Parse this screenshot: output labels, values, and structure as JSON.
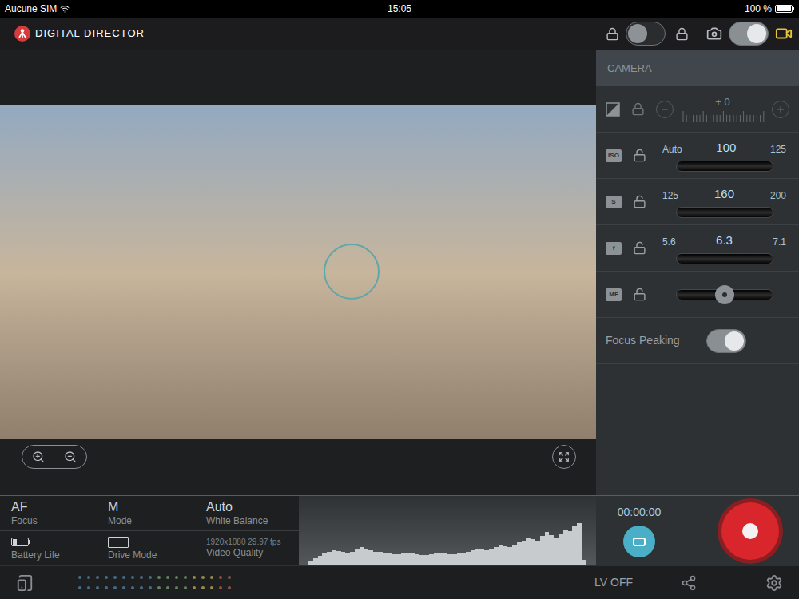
{
  "status_bar": {
    "carrier": "Aucune SIM",
    "time": "15:05",
    "battery": "100 %"
  },
  "app": {
    "title": "DIGITAL DIRECTOR"
  },
  "header": {
    "lock_switch": {
      "on": false
    },
    "mode_switch": {
      "video_selected": true
    }
  },
  "camera_panel": {
    "title": "CAMERA",
    "rows": [
      {
        "kind": "exposure",
        "value": "+ 0",
        "locked": true,
        "disabled": true
      },
      {
        "kind": "dial",
        "badge": "ISO",
        "locked": false,
        "left": "Auto",
        "value": "100",
        "right": "125"
      },
      {
        "kind": "dial",
        "badge": "S",
        "locked": false,
        "left": "125",
        "value": "160",
        "right": "200"
      },
      {
        "kind": "dial",
        "badge": "f",
        "locked": false,
        "left": "5.6",
        "value": "6.3",
        "right": "7.1"
      },
      {
        "kind": "focus",
        "badge": "MF",
        "locked": false,
        "level": 0.5
      },
      {
        "kind": "toggle",
        "label": "Focus Peaking",
        "on": true
      }
    ]
  },
  "info": [
    {
      "kind": "text",
      "value": "AF",
      "label": "Focus"
    },
    {
      "kind": "text",
      "value": "M",
      "label": "Mode"
    },
    {
      "kind": "text",
      "value": "Auto",
      "label": "White Balance"
    },
    {
      "kind": "battery",
      "level": 0.3,
      "label": "Battery Life"
    },
    {
      "kind": "drive",
      "label": "Drive Mode"
    },
    {
      "kind": "small",
      "value": "1920x1080 29.97 fps",
      "label": "Video Quality"
    }
  ],
  "histogram": {
    "values": [
      6,
      10,
      14,
      18,
      20,
      22,
      21,
      19,
      18,
      20,
      23,
      26,
      24,
      22,
      20,
      19,
      18,
      17,
      16,
      16,
      17,
      18,
      17,
      16,
      15,
      15,
      16,
      17,
      18,
      17,
      16,
      16,
      17,
      18,
      20,
      22,
      24,
      23,
      22,
      24,
      27,
      30,
      28,
      26,
      29,
      33,
      36,
      40,
      38,
      35,
      42,
      48,
      44,
      40,
      46,
      52,
      50,
      58,
      61,
      8
    ]
  },
  "recording": {
    "timer": "00:00:00",
    "recording": false
  },
  "audio_meter": {
    "channels": [
      {
        "level": 0
      },
      {
        "level": 0
      }
    ],
    "dot_colors": [
      "#5a8fb4",
      "#5a8fb4",
      "#5a8fb4",
      "#5a8fb4",
      "#5a8fb4",
      "#5a8fb4",
      "#5a8fb4",
      "#5a8fb4",
      "#5a8fb4",
      "#7fae78",
      "#7fae78",
      "#7fae78",
      "#7fae78",
      "#cdbb5a",
      "#cdbb5a",
      "#cdbb5a",
      "#c9625a",
      "#c9625a"
    ]
  },
  "footer": {
    "live_view_label": "LV OFF"
  }
}
